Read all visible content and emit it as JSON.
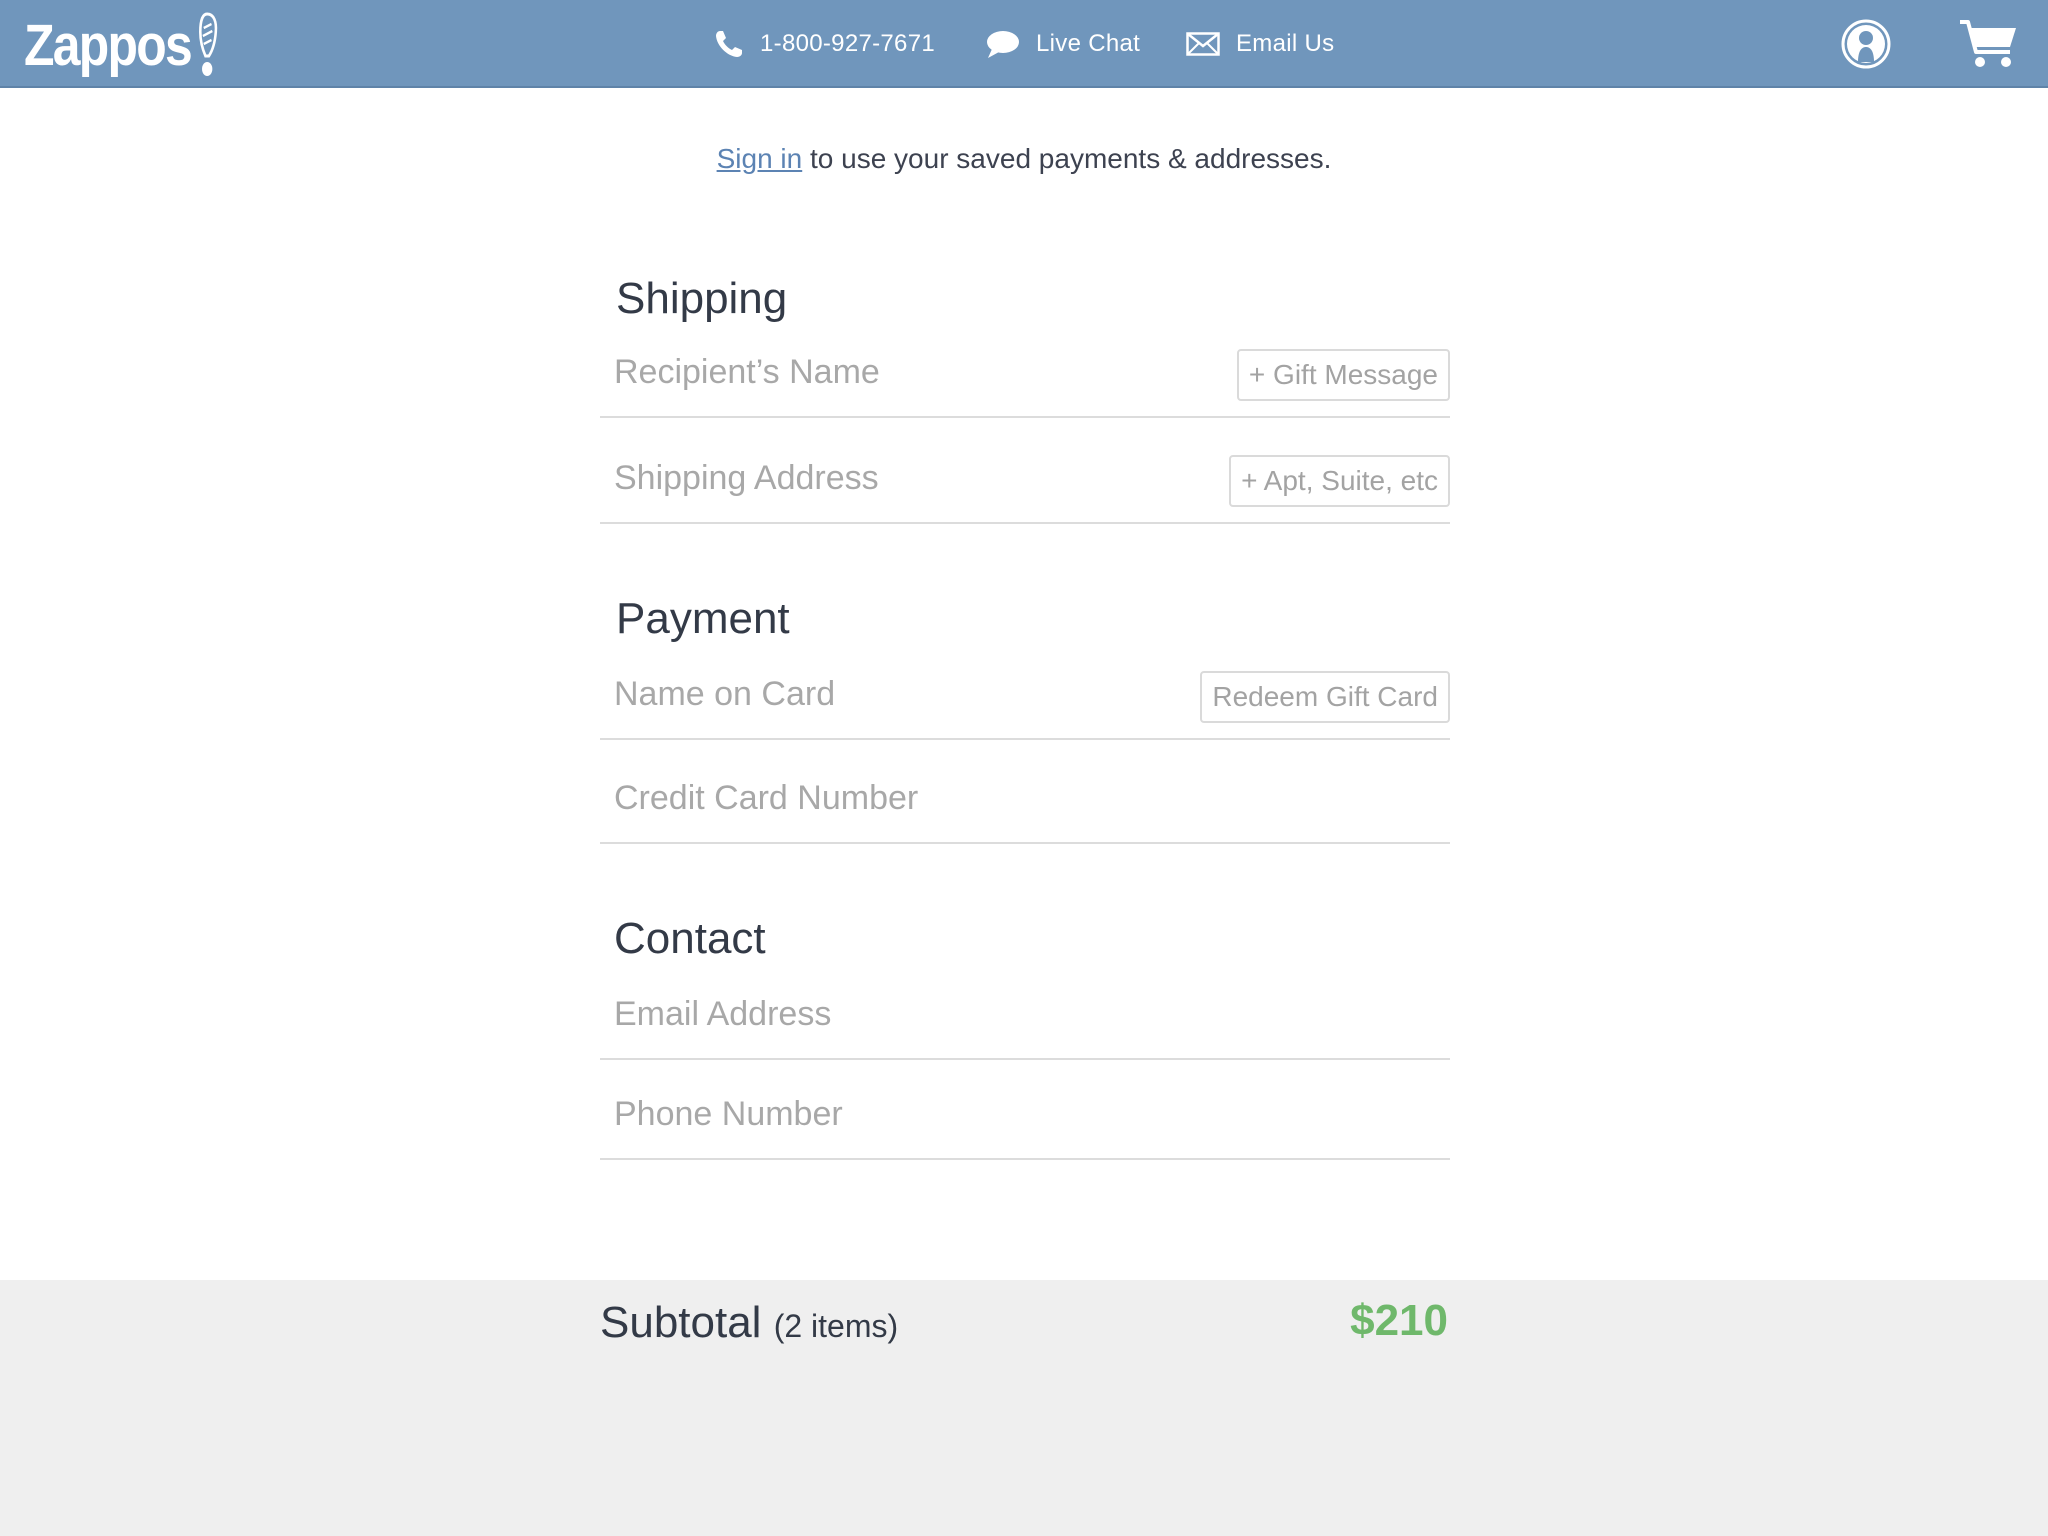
{
  "header": {
    "logo_text": "Zappos",
    "phone": "1-800-927-7671",
    "live_chat": "Live Chat",
    "email_us": "Email Us",
    "icons": {
      "phone": "phone-icon",
      "chat": "chat-bubble-icon",
      "email": "envelope-icon",
      "account": "account-icon",
      "cart": "cart-icon"
    }
  },
  "signin": {
    "link_text": "Sign in",
    "rest_text": " to use your saved payments & addresses."
  },
  "shipping": {
    "title": "Shipping",
    "recipient_placeholder": "Recipient’s Name",
    "gift_message_label": "+ Gift Message",
    "address_placeholder": "Shipping Address",
    "apt_label": "+ Apt, Suite, etc"
  },
  "payment": {
    "title": "Payment",
    "name_on_card_placeholder": "Name on Card",
    "redeem_label": "Redeem Gift Card",
    "card_number_placeholder": "Credit Card Number"
  },
  "contact": {
    "title": "Contact",
    "email_placeholder": "Email Address",
    "phone_placeholder": "Phone Number"
  },
  "summary": {
    "label": "Subtotal",
    "count": "(2 items)",
    "amount": "$210"
  },
  "colors": {
    "header_bg": "#7096bc",
    "link": "#5c83b3",
    "price": "#6fb86b",
    "footer_bg": "#efefef"
  }
}
